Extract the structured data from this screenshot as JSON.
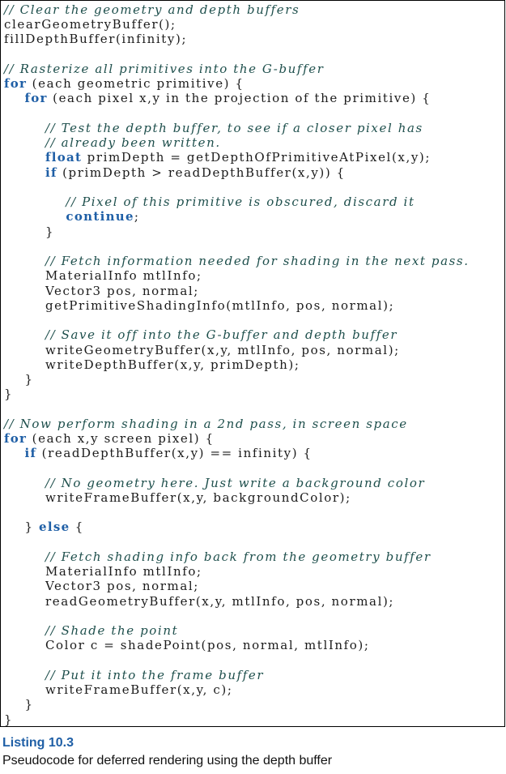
{
  "listing": {
    "lines": [
      [
        {
          "type": "comment",
          "text": "// Clear the geometry and depth buffers"
        }
      ],
      [
        {
          "type": "plain",
          "text": "clearGeometryBuffer();"
        }
      ],
      [
        {
          "type": "plain",
          "text": "fillDepthBuffer(infinity);"
        }
      ],
      [],
      [
        {
          "type": "comment",
          "text": "// Rasterize all primitives into the G-buffer"
        }
      ],
      [
        {
          "type": "kw",
          "text": "for"
        },
        {
          "type": "plain",
          "text": " (each geometric primitive) {"
        }
      ],
      [
        {
          "type": "plain",
          "text": "    "
        },
        {
          "type": "kw",
          "text": "for"
        },
        {
          "type": "plain",
          "text": " (each pixel x,y in the projection of the primitive) {"
        }
      ],
      [],
      [
        {
          "type": "plain",
          "text": "        "
        },
        {
          "type": "comment",
          "text": "// Test the depth buffer, to see if a closer pixel has"
        }
      ],
      [
        {
          "type": "plain",
          "text": "        "
        },
        {
          "type": "comment",
          "text": "// already been written."
        }
      ],
      [
        {
          "type": "plain",
          "text": "        "
        },
        {
          "type": "kw",
          "text": "float"
        },
        {
          "type": "plain",
          "text": " primDepth = getDepthOfPrimitiveAtPixel(x,y);"
        }
      ],
      [
        {
          "type": "plain",
          "text": "        "
        },
        {
          "type": "kw",
          "text": "if"
        },
        {
          "type": "plain",
          "text": " (primDepth > readDepthBuffer(x,y)) {"
        }
      ],
      [],
      [
        {
          "type": "plain",
          "text": "            "
        },
        {
          "type": "comment",
          "text": "// Pixel of this primitive is obscured, discard it"
        }
      ],
      [
        {
          "type": "plain",
          "text": "            "
        },
        {
          "type": "kw",
          "text": "continue"
        },
        {
          "type": "plain",
          "text": ";"
        }
      ],
      [
        {
          "type": "plain",
          "text": "        }"
        }
      ],
      [],
      [
        {
          "type": "plain",
          "text": "        "
        },
        {
          "type": "comment",
          "text": "// Fetch information needed for shading in the next pass."
        }
      ],
      [
        {
          "type": "plain",
          "text": "        MaterialInfo mtlInfo;"
        }
      ],
      [
        {
          "type": "plain",
          "text": "        Vector3 pos, normal;"
        }
      ],
      [
        {
          "type": "plain",
          "text": "        getPrimitiveShadingInfo(mtlInfo, pos, normal);"
        }
      ],
      [],
      [
        {
          "type": "plain",
          "text": "        "
        },
        {
          "type": "comment",
          "text": "// Save it off into the G-buffer and depth buffer"
        }
      ],
      [
        {
          "type": "plain",
          "text": "        writeGeometryBuffer(x,y, mtlInfo, pos, normal);"
        }
      ],
      [
        {
          "type": "plain",
          "text": "        writeDepthBuffer(x,y, primDepth);"
        }
      ],
      [
        {
          "type": "plain",
          "text": "    }"
        }
      ],
      [
        {
          "type": "plain",
          "text": "}"
        }
      ],
      [],
      [
        {
          "type": "comment",
          "text": "// Now perform shading in a 2nd pass, in screen space"
        }
      ],
      [
        {
          "type": "kw",
          "text": "for"
        },
        {
          "type": "plain",
          "text": " (each x,y screen pixel) {"
        }
      ],
      [
        {
          "type": "plain",
          "text": "    "
        },
        {
          "type": "kw",
          "text": "if"
        },
        {
          "type": "plain",
          "text": " (readDepthBuffer(x,y) == infinity) {"
        }
      ],
      [],
      [
        {
          "type": "plain",
          "text": "        "
        },
        {
          "type": "comment",
          "text": "// No geometry here. Just write a background color"
        }
      ],
      [
        {
          "type": "plain",
          "text": "        writeFrameBuffer(x,y, backgroundColor);"
        }
      ],
      [],
      [
        {
          "type": "plain",
          "text": "    } "
        },
        {
          "type": "kw",
          "text": "else"
        },
        {
          "type": "plain",
          "text": " {"
        }
      ],
      [],
      [
        {
          "type": "plain",
          "text": "        "
        },
        {
          "type": "comment",
          "text": "// Fetch shading info back from the geometry buffer"
        }
      ],
      [
        {
          "type": "plain",
          "text": "        MaterialInfo mtlInfo;"
        }
      ],
      [
        {
          "type": "plain",
          "text": "        Vector3 pos, normal;"
        }
      ],
      [
        {
          "type": "plain",
          "text": "        readGeometryBuffer(x,y, mtlInfo, pos, normal);"
        }
      ],
      [],
      [
        {
          "type": "plain",
          "text": "        "
        },
        {
          "type": "comment",
          "text": "// Shade the point"
        }
      ],
      [
        {
          "type": "plain",
          "text": "        Color c = shadePoint(pos, normal, mtlInfo);"
        }
      ],
      [],
      [
        {
          "type": "plain",
          "text": "        "
        },
        {
          "type": "comment",
          "text": "// Put it into the frame buffer"
        }
      ],
      [
        {
          "type": "plain",
          "text": "        writeFrameBuffer(x,y, c);"
        }
      ],
      [
        {
          "type": "plain",
          "text": "    }"
        }
      ],
      [
        {
          "type": "plain",
          "text": "}"
        }
      ]
    ]
  },
  "caption": {
    "title": "Listing 10.3",
    "text": "Pseudocode for deferred rendering using the depth buffer"
  },
  "colors": {
    "keyword": "#1f5fa6",
    "comment": "#1e4f4c",
    "caption_title": "#1f5fa6"
  }
}
